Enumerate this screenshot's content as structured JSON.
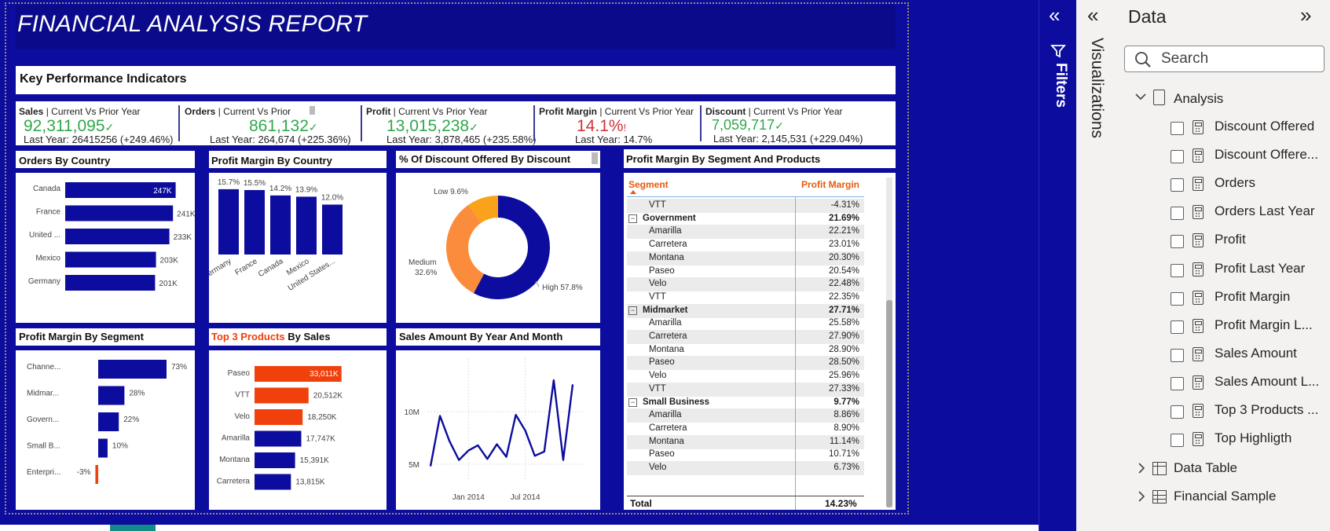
{
  "report": {
    "title": "FINANCIAL ANALYSIS REPORT"
  },
  "kpi_section": {
    "title": "Key Performance Indicators"
  },
  "kpis": [
    {
      "name": "Sales",
      "sub": "Current Vs Prior Year",
      "value": "92,311,095",
      "status": "✓",
      "last_year": "Last Year: 26415256 (+249.46%)"
    },
    {
      "name": "Orders",
      "sub": "Current Vs Prior",
      "value": "861,132",
      "status": "✓",
      "last_year": "Last Year: 264,674 (+225.36%)"
    },
    {
      "name": "Profit",
      "sub": "Current Vs Prior Year",
      "value": "13,015,238",
      "status": "✓",
      "last_year": "Last Year: 3,878,465 (+235.58%)"
    },
    {
      "name": "Profit Margin",
      "sub": "Current Vs Prior Year",
      "value": "14.1%",
      "status": "!",
      "last_year": "Last Year: 14.7%"
    },
    {
      "name": "Discount",
      "sub": "Current Vs Prior Year",
      "value": "7,059,717",
      "status": "✓",
      "last_year": "Last Year: 2,145,531 (+229.04%)"
    }
  ],
  "cards": {
    "orders_by_country": "Orders By Country",
    "profit_margin_by_country": "Profit Margin By Country",
    "discount_offered": "% Of Discount Offered By Discount",
    "profit_margin_segment_products": "Profit Margin By Segment And Products",
    "profit_margin_by_segment": "Profit Margin By Segment",
    "top3_prefix": "Top 3 Products",
    "top3_suffix": " By Sales",
    "sales_by_year_month": "Sales Amount By Year And Month"
  },
  "chart_data": [
    {
      "type": "bar",
      "title": "Orders By Country",
      "orientation": "horizontal",
      "categories": [
        "Canada",
        "France",
        "United ...",
        "Mexico",
        "Germany"
      ],
      "values": [
        247,
        241,
        233,
        203,
        201
      ],
      "labels": [
        "247K",
        "241K",
        "233K",
        "203K",
        "201K"
      ],
      "xlim": [
        0,
        260
      ]
    },
    {
      "type": "bar",
      "title": "Profit Margin By Country",
      "categories": [
        "Germany",
        "France",
        "Canada",
        "Mexico",
        "United States..."
      ],
      "values": [
        15.7,
        15.5,
        14.2,
        13.9,
        12.0
      ],
      "labels": [
        "15.7%",
        "15.5%",
        "14.2%",
        "13.9%",
        "12.0%"
      ],
      "ylim": [
        0,
        17
      ]
    },
    {
      "type": "pie",
      "title": "% Of Discount Offered By Discount",
      "categories": [
        "High",
        "Medium",
        "Low"
      ],
      "values": [
        57.8,
        32.6,
        9.6
      ],
      "labels": [
        "High 57.8%",
        "Medium 32.6%",
        "Low 9.6%"
      ],
      "colors": [
        "#0c0c9e",
        "#fb8c3c",
        "#f9a21a"
      ]
    },
    {
      "type": "bar",
      "title": "Profit Margin By Segment",
      "orientation": "horizontal",
      "categories": [
        "Channe...",
        "Midmar...",
        "Govern...",
        "Small B...",
        "Enterpri..."
      ],
      "values": [
        73,
        28,
        22,
        10,
        -3
      ],
      "labels": [
        "73%",
        "28%",
        "22%",
        "10%",
        "-3%"
      ],
      "xlim": [
        -5,
        80
      ]
    },
    {
      "type": "bar",
      "title": "Top 3 Products By Sales",
      "orientation": "horizontal",
      "categories": [
        "Paseo",
        "VTT",
        "Velo",
        "Amarilla",
        "Montana",
        "Carretera"
      ],
      "values": [
        33011,
        20512,
        18250,
        17747,
        15391,
        13815
      ],
      "labels": [
        "33,011K",
        "20,512K",
        "18,250K",
        "17,747K",
        "15,391K",
        "13,815K"
      ],
      "highlight": [
        true,
        true,
        true,
        false,
        false,
        false
      ],
      "xlim": [
        0,
        34000
      ]
    },
    {
      "type": "line",
      "title": "Sales Amount By Year And Month",
      "x": [
        "2013-09",
        "2013-10",
        "2013-11",
        "2013-12",
        "2014-01",
        "2014-02",
        "2014-03",
        "2014-04",
        "2014-05",
        "2014-06",
        "2014-07",
        "2014-08",
        "2014-09",
        "2014-10",
        "2014-11",
        "2014-12"
      ],
      "values": [
        4.8,
        9.6,
        7.2,
        5.4,
        6.3,
        6.8,
        5.5,
        6.9,
        5.7,
        9.7,
        8.2,
        5.8,
        6.2,
        13.0,
        5.4,
        12.6
      ],
      "xticks": [
        "Jan 2014",
        "Jul 2014"
      ],
      "yticks": [
        "5M",
        "10M"
      ],
      "ylim": [
        3.5,
        14.5
      ]
    },
    {
      "type": "table",
      "title": "Profit Margin By Segment And Products",
      "columns": [
        "Segment",
        "Profit Margin"
      ],
      "rows": [
        {
          "segment": "VTT",
          "value": "-4.31%",
          "group": false
        },
        {
          "segment": "Government",
          "value": "21.69%",
          "group": true
        },
        {
          "segment": "Amarilla",
          "value": "22.21%",
          "group": false
        },
        {
          "segment": "Carretera",
          "value": "23.01%",
          "group": false
        },
        {
          "segment": "Montana",
          "value": "20.30%",
          "group": false
        },
        {
          "segment": "Paseo",
          "value": "20.54%",
          "group": false
        },
        {
          "segment": "Velo",
          "value": "22.48%",
          "group": false
        },
        {
          "segment": "VTT",
          "value": "22.35%",
          "group": false
        },
        {
          "segment": "Midmarket",
          "value": "27.71%",
          "group": true
        },
        {
          "segment": "Amarilla",
          "value": "25.58%",
          "group": false
        },
        {
          "segment": "Carretera",
          "value": "27.90%",
          "group": false
        },
        {
          "segment": "Montana",
          "value": "28.90%",
          "group": false
        },
        {
          "segment": "Paseo",
          "value": "28.50%",
          "group": false
        },
        {
          "segment": "Velo",
          "value": "25.96%",
          "group": false
        },
        {
          "segment": "VTT",
          "value": "27.33%",
          "group": false
        },
        {
          "segment": "Small Business",
          "value": "9.77%",
          "group": true
        },
        {
          "segment": "Amarilla",
          "value": "8.86%",
          "group": false
        },
        {
          "segment": "Carretera",
          "value": "8.90%",
          "group": false
        },
        {
          "segment": "Montana",
          "value": "11.14%",
          "group": false
        },
        {
          "segment": "Paseo",
          "value": "10.71%",
          "group": false
        },
        {
          "segment": "Velo",
          "value": "6.73%",
          "group": false
        }
      ],
      "total": {
        "segment": "Total",
        "value": "14.23%"
      }
    }
  ],
  "panes": {
    "filters_label": "Filters",
    "visualizations_label": "Visualizations",
    "data_title": "Data",
    "search_placeholder": "Search",
    "tree_root": "Analysis",
    "fields": [
      "Discount Offered",
      "Discount Offere...",
      "Orders",
      "Orders Last Year",
      "Profit",
      "Profit Last Year",
      "Profit Margin",
      "Profit Margin L...",
      "Sales Amount",
      "Sales Amount L...",
      "Top 3 Products ...",
      "Top Highligth"
    ],
    "tables": [
      "Data Table",
      "Financial Sample"
    ]
  },
  "colors": {
    "canvas": "#0c0c9e",
    "bar": "#0c0c9e",
    "highlight": "#f0400c",
    "positive": "#2fa84a",
    "negative": "#d13438",
    "matrix_header": "#e8590c"
  }
}
